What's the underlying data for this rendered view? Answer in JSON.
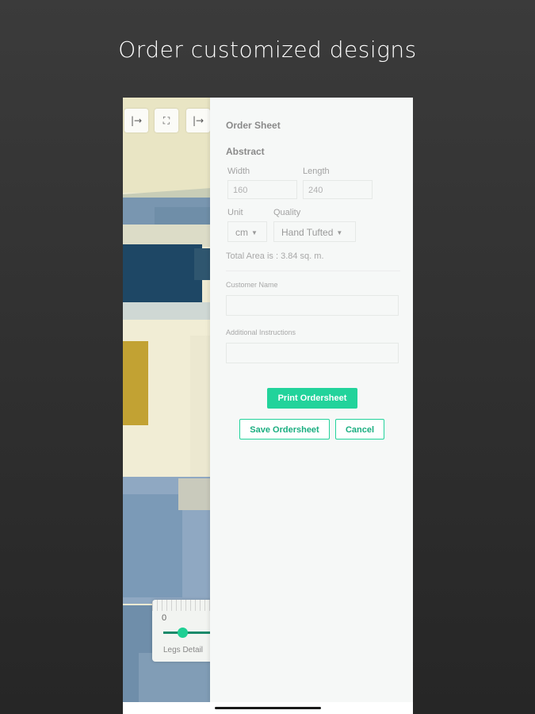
{
  "promo": {
    "title": "Order customized designs"
  },
  "toolbar": {
    "icons": [
      "collapse-right-icon",
      "fullscreen-icon",
      "collapse-right-icon"
    ],
    "glyph_arrow": "|→",
    "glyph_expand": "⛶"
  },
  "legs": {
    "ruler_value": "0",
    "label": "Legs Detail"
  },
  "order_sheet": {
    "title": "Order Sheet",
    "design_name": "Abstract",
    "width_label": "Width",
    "width_value": "160",
    "length_label": "Length",
    "length_value": "240",
    "unit_label": "Unit",
    "unit_value": "cm",
    "quality_label": "Quality",
    "quality_value": "Hand Tufted",
    "total_area": "Total Area is : 3.84 sq. m.",
    "customer_name_label": "Customer Name",
    "customer_name_value": "",
    "instructions_label": "Additional Instructions",
    "instructions_value": "",
    "print_button": "Print Ordersheet",
    "save_button": "Save Ordersheet",
    "cancel_button": "Cancel"
  },
  "colors": {
    "accent": "#22d39b",
    "background": "#2f2f2f",
    "panel": "#f6f8f7"
  }
}
